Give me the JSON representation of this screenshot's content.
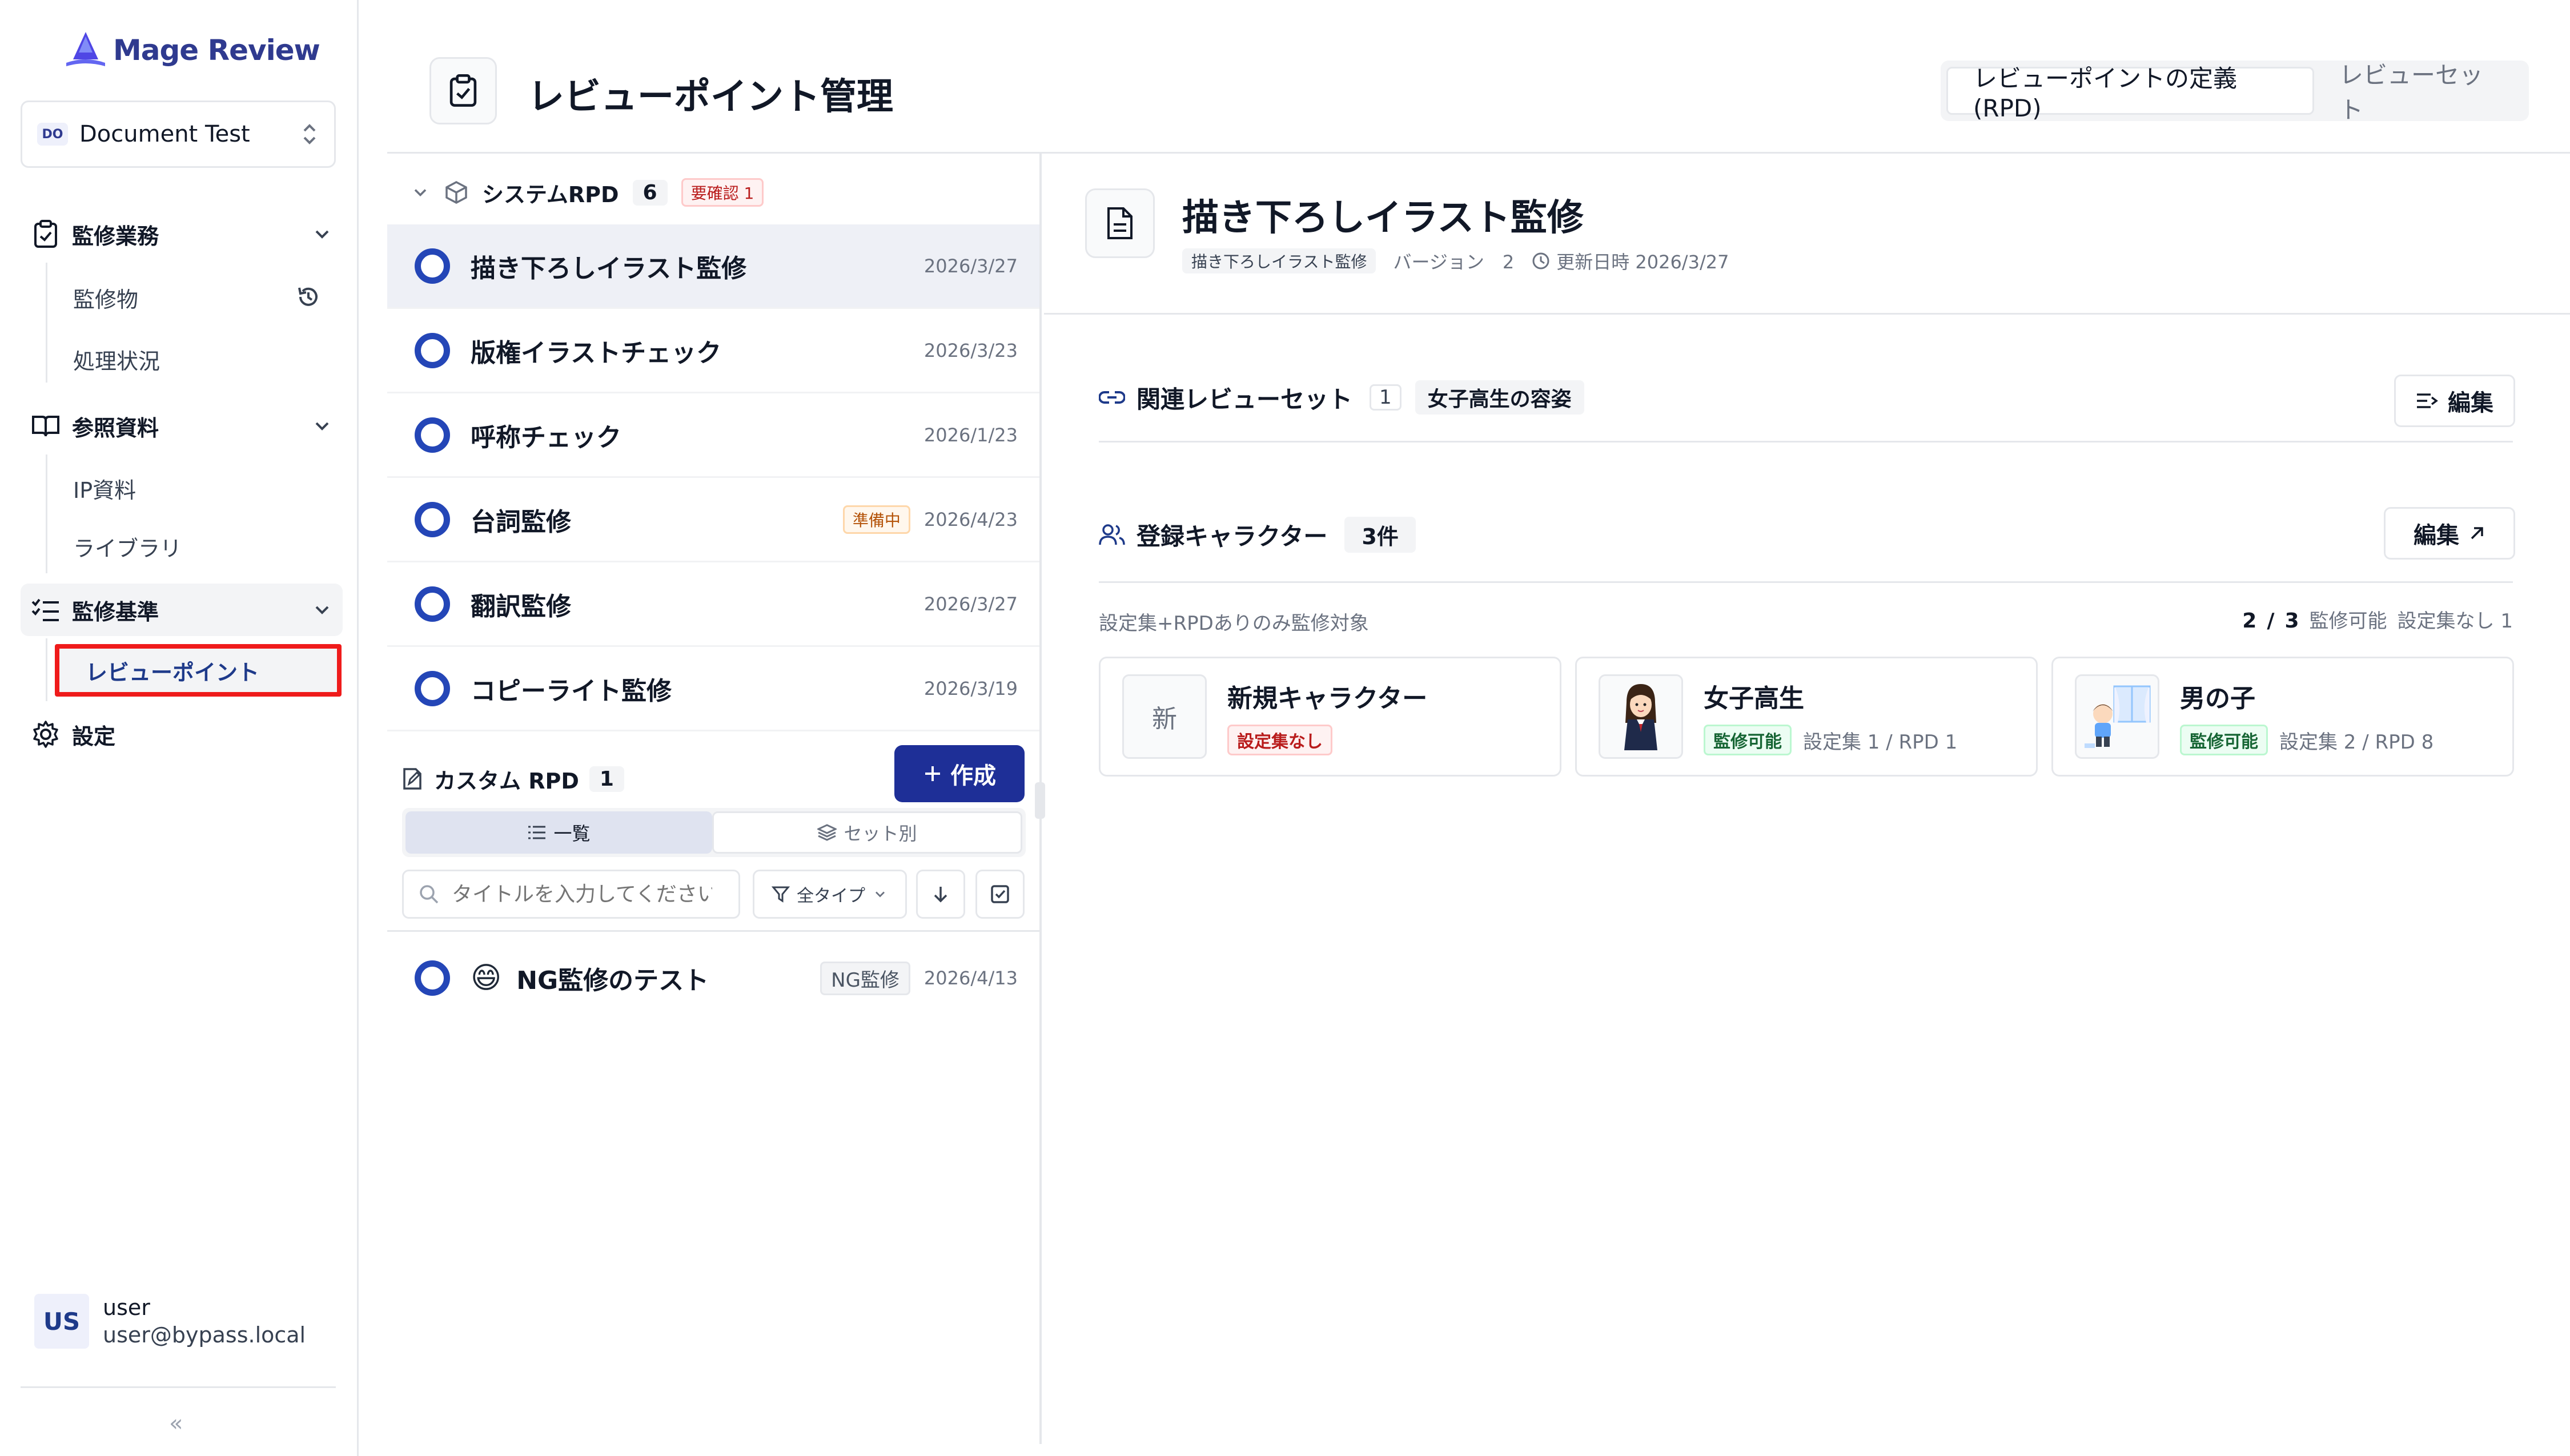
{
  "app": {
    "name": "Mage Review"
  },
  "workspace": {
    "badge": "DO",
    "name": "Document Test"
  },
  "sidebar": {
    "groups": [
      {
        "label": "監修業務",
        "items": [
          "監修物",
          "処理状況"
        ]
      },
      {
        "label": "参照資料",
        "items": [
          "IP資料",
          "ライブラリ"
        ]
      },
      {
        "label": "監修基準",
        "items": [
          "レビューポイント"
        ]
      }
    ],
    "settings_label": "設定"
  },
  "user": {
    "initials": "US",
    "name": "user",
    "email": "user@bypass.local"
  },
  "header": {
    "title": "レビューポイント管理",
    "tabs": [
      "レビューポイントの定義(RPD)",
      "レビューセット"
    ]
  },
  "system_rpd": {
    "title": "システムRPD",
    "count": "6",
    "warning": "要確認 1",
    "items": [
      {
        "title": "描き下ろしイラスト監修",
        "date": "2026/3/27",
        "badge": ""
      },
      {
        "title": "版権イラストチェック",
        "date": "2026/3/23",
        "badge": ""
      },
      {
        "title": "呼称チェック",
        "date": "2026/1/23",
        "badge": ""
      },
      {
        "title": "台詞監修",
        "date": "2026/4/23",
        "badge": "準備中"
      },
      {
        "title": "翻訳監修",
        "date": "2026/3/27",
        "badge": ""
      },
      {
        "title": "コピーライト監修",
        "date": "2026/3/19",
        "badge": ""
      }
    ]
  },
  "custom_rpd": {
    "title": "カスタム RPD",
    "count": "1",
    "create_label": "作成",
    "view_list": "一覧",
    "view_set": "セット別",
    "search_placeholder": "タイトルを入力してください",
    "filter_label": "全タイプ",
    "items": [
      {
        "emoji": "😄",
        "title": "NG監修のテスト",
        "badge": "NG監修",
        "date": "2026/4/13"
      }
    ]
  },
  "detail": {
    "title": "描き下ろしイラスト監修",
    "tag": "描き下ろしイラスト監修",
    "version": "バージョン　2",
    "updated": "更新日時 2026/3/27",
    "review_sets": {
      "title": "関連レビューセット",
      "count": "1",
      "tag": "女子高生の容姿",
      "edit_label": "編集"
    },
    "characters": {
      "title": "登録キャラクター",
      "count": "3件",
      "edit_label": "編集",
      "note_left": "設定集+RPDありのみ監修対象",
      "ratio_ok": "2",
      "ratio_sep": "/",
      "ratio_total": "3",
      "ratio_label": "監修可能",
      "no_setting": "設定集なし 1",
      "cards": [
        {
          "thumb": "新",
          "name": "新規キャラクター",
          "badge": "設定集なし",
          "info": ""
        },
        {
          "thumb": "",
          "name": "女子高生",
          "badge": "監修可能",
          "info": "設定集 1 / RPD 1"
        },
        {
          "thumb": "",
          "name": "男の子",
          "badge": "監修可能",
          "info": "設定集 2 / RPD 8"
        }
      ]
    }
  },
  "colors": {
    "accent": "#1e2f97",
    "ring": "#2446b7",
    "highlight_border": "#ef1b1b"
  }
}
